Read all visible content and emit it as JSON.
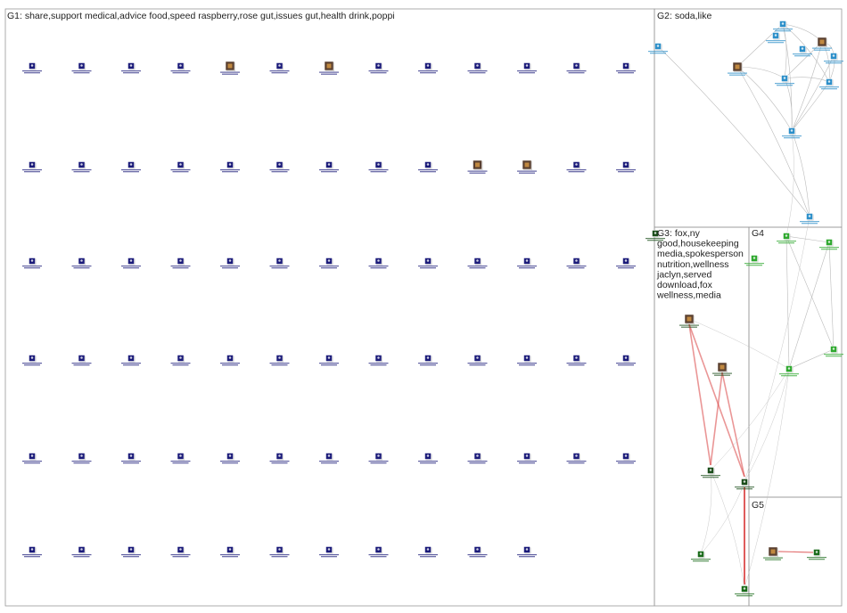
{
  "groups": [
    {
      "id": "G1",
      "label_lines": [
        "G1: share,support  medical,advice  food,speed  raspberry,rose  gut,issues  gut,health  drink,poppi"
      ]
    },
    {
      "id": "G2",
      "label_lines": [
        "G2: soda,like"
      ]
    },
    {
      "id": "G3",
      "label_lines": [
        "G3: fox,ny",
        "good,housekeeping",
        "media,spokesperson",
        "nutrition,wellness",
        "jaclyn,served",
        "download,fox",
        "wellness,media"
      ]
    },
    {
      "id": "G4",
      "label_lines": [
        "G4"
      ]
    },
    {
      "id": "G5",
      "label_lines": [
        "G5"
      ]
    }
  ],
  "colors": {
    "g1_node": "#1c1c7a",
    "g2_node": "#2c8fc9",
    "g3_node": "#1a4d1a",
    "g4_node": "#2ea82e",
    "g5_node": "#1a6b1a",
    "edge": "#bbbbbb",
    "edge_strong": "#d94040",
    "border": "#999999"
  },
  "g1": {
    "rows": 6,
    "cols": 13,
    "last_row_count": 11,
    "photo_nodes": [
      4,
      6,
      22,
      23
    ]
  },
  "g2": {
    "node_count": 11
  },
  "g3": {
    "node_count": 5
  },
  "g4": {
    "node_count": 5
  },
  "g5": {
    "node_count": 4
  }
}
